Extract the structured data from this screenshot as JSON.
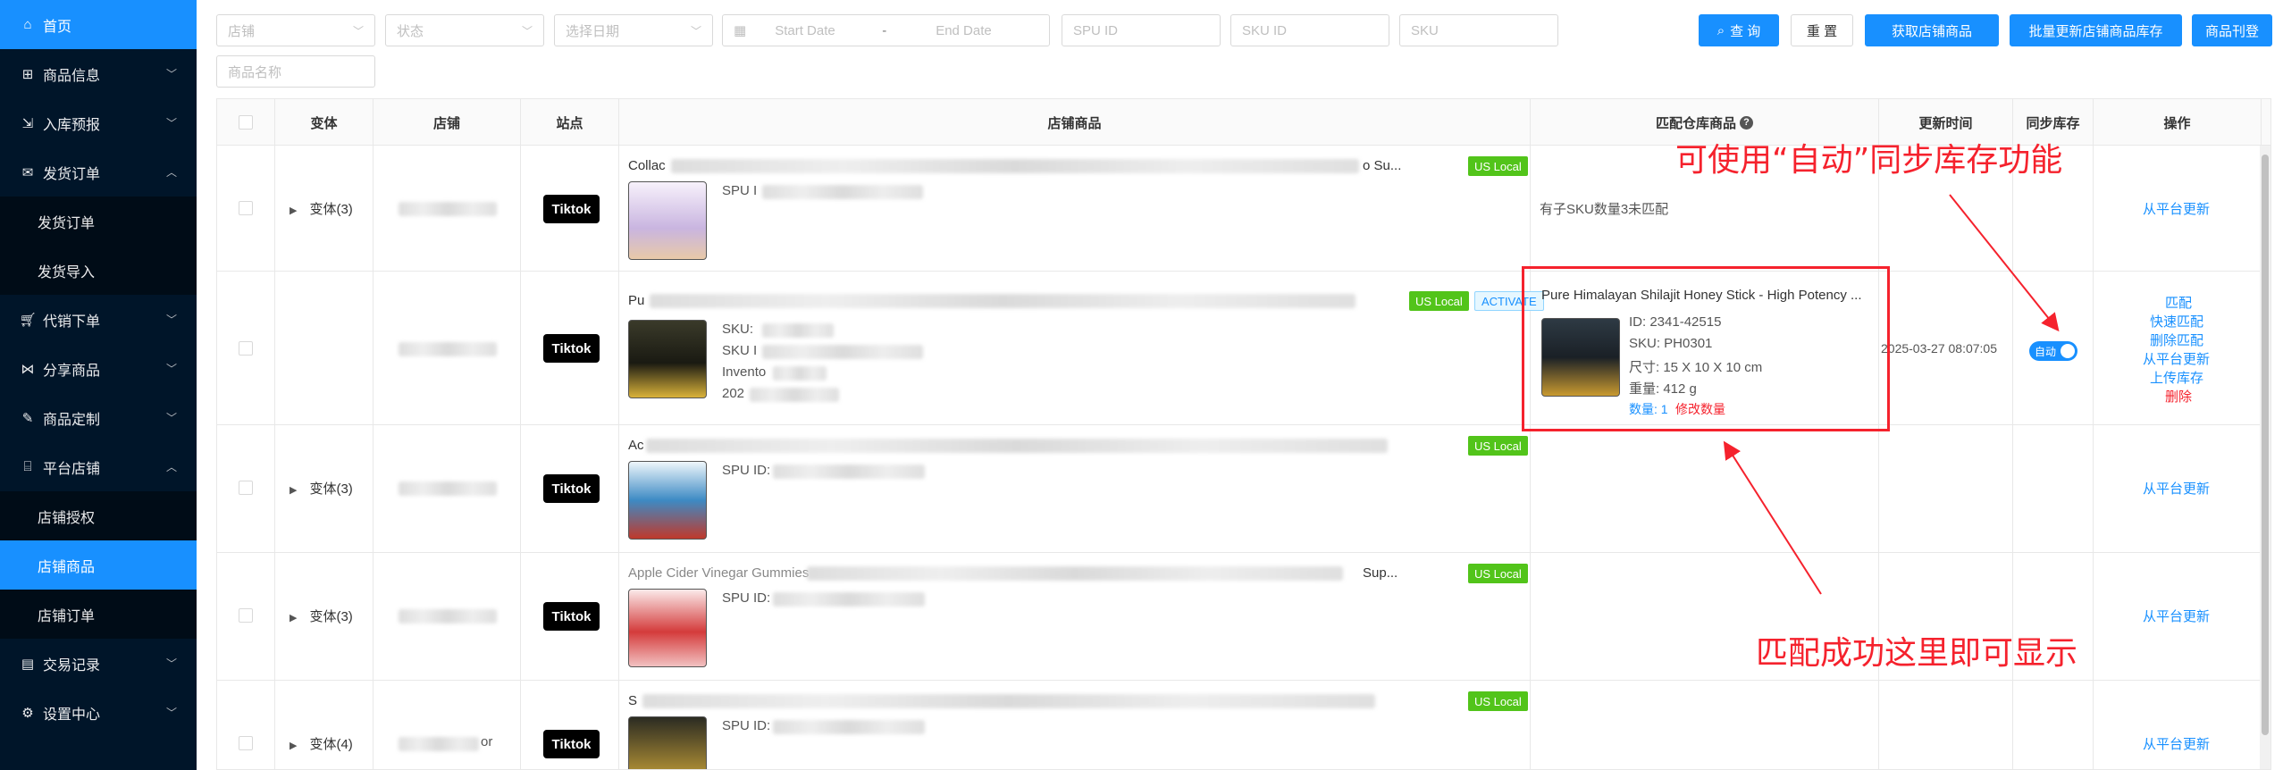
{
  "sidebar": {
    "items": [
      {
        "label": "首页",
        "icon": "home-icon",
        "active": true
      },
      {
        "label": "商品信息",
        "icon": "gift-icon"
      },
      {
        "label": "入库预报",
        "icon": "inbound-icon"
      },
      {
        "label": "发货订单",
        "icon": "mail-icon",
        "expanded": true
      },
      {
        "label": "发货订单",
        "sub": true
      },
      {
        "label": "发货导入",
        "sub": true
      },
      {
        "label": "代销下单",
        "icon": "cart-icon"
      },
      {
        "label": "分享商品",
        "icon": "share-icon"
      },
      {
        "label": "商品定制",
        "icon": "customize-icon"
      },
      {
        "label": "平台店铺",
        "icon": "store-icon",
        "expanded": true
      },
      {
        "label": "店铺授权",
        "sub": true
      },
      {
        "label": "店铺商品",
        "sub": true,
        "active": true
      },
      {
        "label": "店铺订单",
        "sub": true
      },
      {
        "label": "交易记录",
        "icon": "record-icon"
      },
      {
        "label": "设置中心",
        "icon": "settings-icon"
      }
    ]
  },
  "filters": {
    "store_placeholder": "店铺",
    "status_placeholder": "状态",
    "date_type_placeholder": "选择日期",
    "start_date_placeholder": "Start Date",
    "date_separator": "-",
    "end_date_placeholder": "End Date",
    "spu_placeholder": "SPU ID",
    "sku_id_placeholder": "SKU ID",
    "sku_placeholder": "SKU",
    "product_name_placeholder": "商品名称"
  },
  "toolbar": {
    "query_label": "查 询",
    "reset_label": "重 置",
    "fetch_label": "获取店铺商品",
    "batch_update_label": "批量更新店铺商品库存",
    "publish_label": "商品刊登"
  },
  "table": {
    "headers": {
      "variant": "变体",
      "store": "店铺",
      "site": "站点",
      "store_product": "店铺商品",
      "warehouse_product": "匹配仓库商品",
      "update_time": "更新时间",
      "sync_stock": "同步库存",
      "actions": "操作"
    },
    "rows": [
      {
        "variant": "变体(3)",
        "store_visible": "Hami...herbs",
        "site": "Tiktok",
        "title_prefix": "Collac",
        "title_suffix": "o Su...",
        "tag": "US Local",
        "line1": "SPU I",
        "match_text": "有子SKU数量3未匹配",
        "action": "从平台更新"
      },
      {
        "variant": "",
        "site": "Tiktok",
        "title_prefix": "Pu",
        "tag": "US Local",
        "tag2": "ACTIVATE",
        "line1": "SKU: ",
        "line2": "SKU I",
        "line3": "Invento",
        "line4": "202",
        "match": {
          "title": "Pure Himalayan Shilajit Honey Stick - High Potency ...",
          "id": "ID: 2341-42515",
          "sku": "SKU: PH0301",
          "size": "尺寸: 15 X 10 X 10 cm",
          "weight": "重量: 412 g",
          "qty": "数量: 1",
          "edit_qty": "修改数量"
        },
        "update_time": "2025-03-27 08:07:05",
        "sync_label": "自动",
        "actions": [
          "匹配",
          "快速匹配",
          "删除匹配",
          "从平台更新",
          "上传库存",
          "删除"
        ]
      },
      {
        "variant": "变体(3)",
        "site": "Tiktok",
        "title_prefix": "Ac",
        "tag": "US Local",
        "line1": "SPU ID:",
        "action": "从平台更新"
      },
      {
        "variant": "变体(3)",
        "site": "Tiktok",
        "title_prefix": "Apple Cider Vinegar Gummies",
        "title_suffix": "Sup...",
        "tag": "US Local",
        "line1": "SPU ID:",
        "action": "从平台更新"
      },
      {
        "variant": "变体(4)",
        "store_visible": "or",
        "site": "Tiktok",
        "title_prefix": "S",
        "tag": "US Local",
        "line1": "SPU ID:",
        "action": "从平台更新"
      }
    ]
  },
  "annotations": {
    "top": "可使用“自动”同步库存功能",
    "bottom": "匹配成功这里即可显示"
  },
  "colors": {
    "sidebar_bg": "#001529",
    "primary": "#1890ff",
    "annotation_red": "#f5222d",
    "tag_green": "#52c41a"
  }
}
